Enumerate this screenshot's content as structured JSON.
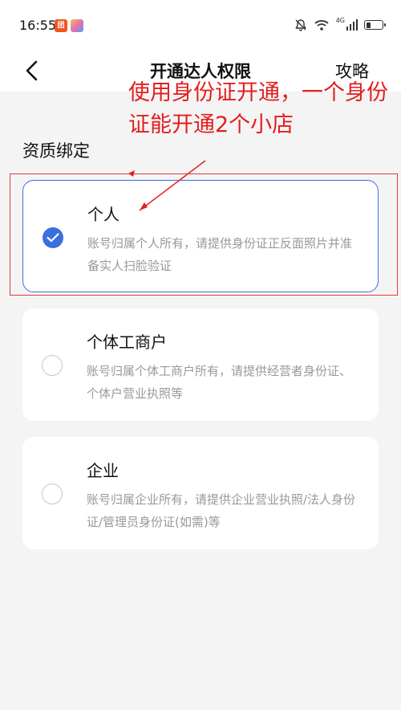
{
  "status_bar": {
    "time": "16:55",
    "network": "4G",
    "battery_fraction": 0.25
  },
  "nav": {
    "back_icon": "chevron-left-icon",
    "title": "开通达人权限",
    "action_label": "攻略"
  },
  "section": {
    "title": "资质绑定"
  },
  "options": [
    {
      "title": "个人",
      "description": "账号归属个人所有，请提供身份证正反面照片并准备实人扫脸验证",
      "selected": true
    },
    {
      "title": "个体工商户",
      "description": "账号归属个体工商户所有，请提供经营者身份证、个体户营业执照等",
      "selected": false
    },
    {
      "title": "企业",
      "description": "账号归属企业所有，请提供企业营业执照/法人身份证/管理员身份证(如需)等",
      "selected": false
    }
  ],
  "annotation": {
    "text": "使用身份证开通，一个身份证能开通2个小店",
    "color": "#e31e1e"
  },
  "colors": {
    "accent": "#3a6fe0",
    "annotation": "#e31e1e"
  }
}
